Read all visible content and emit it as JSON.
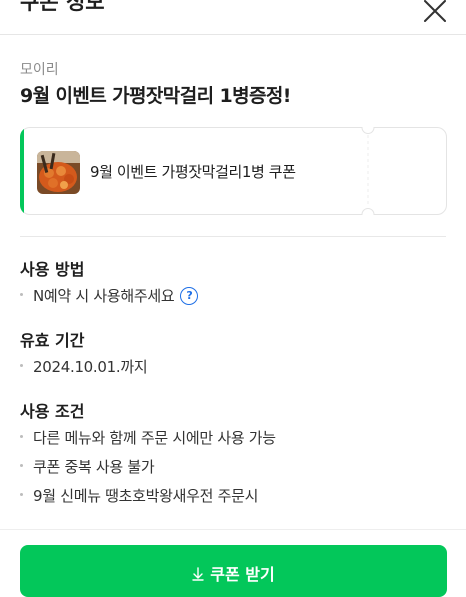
{
  "header": {
    "title": "쿠폰 정보"
  },
  "coupon_info": {
    "store": "모이리",
    "title": "9월 이벤트 가평잣막걸리 1병증정!",
    "coupon_name": "9월 이벤트 가평잣막걸리1병 쿠폰"
  },
  "usage": {
    "title": "사용 방법",
    "items": [
      "N예약 시 사용해주세요"
    ]
  },
  "validity": {
    "title": "유효 기간",
    "items": [
      "2024.10.01.까지"
    ]
  },
  "conditions": {
    "title": "사용 조건",
    "items": [
      "다른 메뉴와 함께 주문 시에만 사용 가능",
      "쿠폰 중복 사용 불가",
      "9월 신메뉴 땡초호박왕새우전 주문시"
    ]
  },
  "cta": {
    "label": "쿠폰 받기"
  },
  "colors": {
    "accent": "#03c75a",
    "link": "#1e6fe6"
  },
  "icons": [
    "close-icon",
    "help-icon",
    "download-icon"
  ]
}
